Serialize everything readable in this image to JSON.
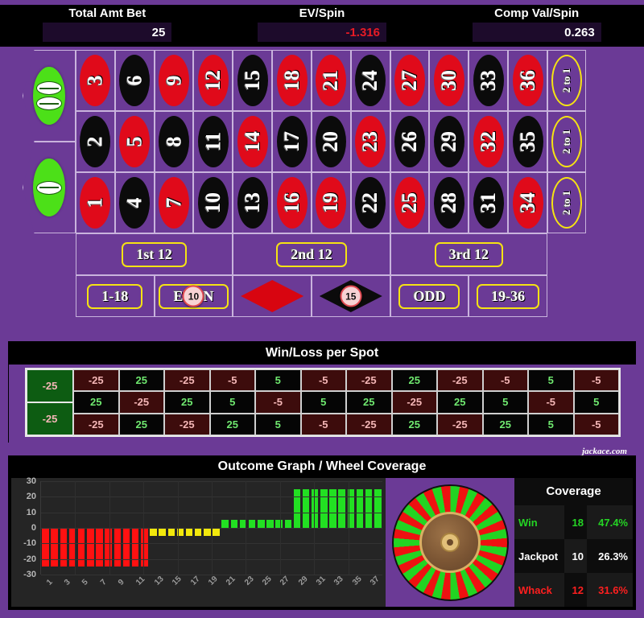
{
  "stats": [
    {
      "label": "Total Amt Bet",
      "value": "25",
      "negative": false
    },
    {
      "label": "EV/Spin",
      "value": "-1.316",
      "negative": true
    },
    {
      "label": "Comp Val/Spin",
      "value": "0.263",
      "negative": false
    }
  ],
  "table": {
    "zeros": [
      {
        "label": "00",
        "glyphs": 2
      },
      {
        "label": "0",
        "glyphs": 1
      }
    ],
    "numbers": [
      {
        "n": "3",
        "color": "red"
      },
      {
        "n": "6",
        "color": "black"
      },
      {
        "n": "9",
        "color": "red"
      },
      {
        "n": "12",
        "color": "red"
      },
      {
        "n": "15",
        "color": "black"
      },
      {
        "n": "18",
        "color": "red"
      },
      {
        "n": "21",
        "color": "red"
      },
      {
        "n": "24",
        "color": "black"
      },
      {
        "n": "27",
        "color": "red"
      },
      {
        "n": "30",
        "color": "red"
      },
      {
        "n": "33",
        "color": "black"
      },
      {
        "n": "36",
        "color": "red"
      },
      {
        "n": "2",
        "color": "black"
      },
      {
        "n": "5",
        "color": "red"
      },
      {
        "n": "8",
        "color": "black"
      },
      {
        "n": "11",
        "color": "black"
      },
      {
        "n": "14",
        "color": "red"
      },
      {
        "n": "17",
        "color": "black"
      },
      {
        "n": "20",
        "color": "black"
      },
      {
        "n": "23",
        "color": "red"
      },
      {
        "n": "26",
        "color": "black"
      },
      {
        "n": "29",
        "color": "black"
      },
      {
        "n": "32",
        "color": "red"
      },
      {
        "n": "35",
        "color": "black"
      },
      {
        "n": "1",
        "color": "red"
      },
      {
        "n": "4",
        "color": "black"
      },
      {
        "n": "7",
        "color": "red"
      },
      {
        "n": "10",
        "color": "black"
      },
      {
        "n": "13",
        "color": "black"
      },
      {
        "n": "16",
        "color": "red"
      },
      {
        "n": "19",
        "color": "red"
      },
      {
        "n": "22",
        "color": "black"
      },
      {
        "n": "25",
        "color": "red"
      },
      {
        "n": "28",
        "color": "black"
      },
      {
        "n": "31",
        "color": "black"
      },
      {
        "n": "34",
        "color": "red"
      }
    ],
    "column_bets": [
      "2 to 1",
      "2 to 1",
      "2 to 1"
    ],
    "dozens": [
      "1st 12",
      "2nd 12",
      "3rd 12"
    ],
    "outside": [
      {
        "label": "1-18",
        "kind": "pill"
      },
      {
        "label": "EVEN",
        "kind": "pill",
        "chip": "10"
      },
      {
        "label": "",
        "kind": "diamond-red"
      },
      {
        "label": "",
        "kind": "diamond-black",
        "chip": "15"
      },
      {
        "label": "ODD",
        "kind": "pill"
      },
      {
        "label": "19-36",
        "kind": "pill"
      }
    ]
  },
  "winloss": {
    "title": "Win/Loss per Spot",
    "zeros": [
      "-25",
      "-25"
    ],
    "rows": [
      [
        "-25",
        "25",
        "-25",
        "-5",
        "5",
        "-5",
        "-25",
        "25",
        "-25",
        "-5",
        "5",
        "-5"
      ],
      [
        "25",
        "-25",
        "25",
        "5",
        "-5",
        "5",
        "25",
        "-25",
        "25",
        "5",
        "-5",
        "5"
      ],
      [
        "-25",
        "25",
        "-25",
        "25",
        "5",
        "-5",
        "-25",
        "25",
        "-25",
        "25",
        "5",
        "-5"
      ]
    ],
    "watermark": "jackace.com"
  },
  "outcome": {
    "title": "Outcome Graph / Wheel Coverage",
    "coverage_title": "Coverage",
    "coverage": [
      {
        "name": "Win",
        "count": "18",
        "pct": "47.4%",
        "style": "win"
      },
      {
        "name": "Jackpot",
        "count": "10",
        "pct": "26.3%",
        "style": "jack"
      },
      {
        "name": "Whack",
        "count": "12",
        "pct": "31.6%",
        "style": "whack"
      }
    ]
  },
  "chart_data": {
    "type": "bar",
    "title": "Outcome Graph / Wheel Coverage",
    "xlabel": "",
    "ylabel": "",
    "ylim": [
      -30,
      30
    ],
    "yticks": [
      30,
      20,
      10,
      0,
      -10,
      -20,
      -30
    ],
    "grid": true,
    "legend": "none",
    "x": [
      1,
      2,
      3,
      4,
      5,
      6,
      7,
      8,
      9,
      10,
      11,
      12,
      13,
      14,
      15,
      16,
      17,
      18,
      19,
      20,
      21,
      22,
      23,
      24,
      25,
      26,
      27,
      28,
      29,
      30,
      31,
      32,
      33,
      34,
      35,
      36,
      37,
      38
    ],
    "xtick_labels": [
      "1",
      "3",
      "5",
      "7",
      "9",
      "11",
      "13",
      "15",
      "17",
      "19",
      "21",
      "23",
      "25",
      "27",
      "29",
      "31",
      "33",
      "35",
      "37"
    ],
    "values": [
      -25,
      -25,
      -25,
      -25,
      -25,
      -25,
      -25,
      -25,
      -25,
      -25,
      -25,
      -25,
      -5,
      -5,
      -5,
      -5,
      -5,
      -5,
      -5,
      -5,
      5,
      5,
      5,
      5,
      5,
      5,
      5,
      5,
      25,
      25,
      25,
      25,
      25,
      25,
      25,
      25,
      25,
      25
    ],
    "bar_colors": [
      "#ff1111",
      "#ff1111",
      "#ff1111",
      "#ff1111",
      "#ff1111",
      "#ff1111",
      "#ff1111",
      "#ff1111",
      "#ff1111",
      "#ff1111",
      "#ff1111",
      "#ff1111",
      "#f2e80c",
      "#f2e80c",
      "#f2e80c",
      "#f2e80c",
      "#f2e80c",
      "#f2e80c",
      "#f2e80c",
      "#f2e80c",
      "#22e022",
      "#22e022",
      "#22e022",
      "#22e022",
      "#22e022",
      "#22e022",
      "#22e022",
      "#22e022",
      "#22e022",
      "#22e022",
      "#22e022",
      "#22e022",
      "#22e022",
      "#22e022",
      "#22e022",
      "#22e022",
      "#22e022",
      "#22e022"
    ]
  },
  "colors": {
    "felt": "#6b3a96",
    "red": "#e00a1a",
    "black": "#0b0b0b",
    "green": "#4ce018",
    "yellow_outline": "#f5e313",
    "ev_negative": "#e81b25"
  }
}
